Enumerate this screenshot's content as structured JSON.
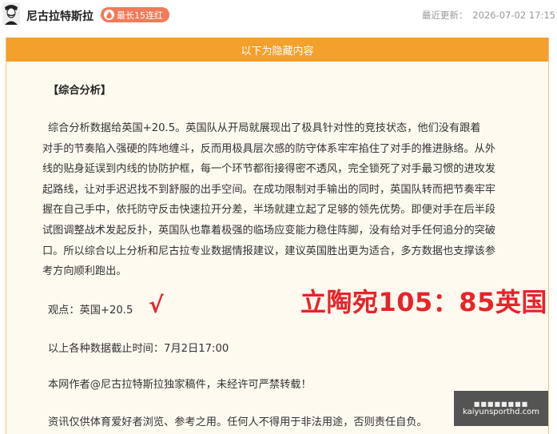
{
  "header": {
    "author": "尼古拉特斯拉",
    "badge": "最长15连红",
    "updated_label": "最近更新：",
    "updated_time": "2026-07-02 17:15"
  },
  "card": {
    "hidden_banner": "以下为隐藏内容",
    "section_title": "【综合分析】",
    "paragraph_lines": [
      "综合分析数据给英国+20.5。英国队从开局就展现出了极具针对性的竞技状态，他们没有跟着",
      "对手的节奏陷入强硬的阵地缠斗，反而用极具层次感的防守体系牢牢掐住了对手的推进脉络。从外",
      "线的贴身延误到内线的协防护框，每一个环节都衔接得密不透风，完全锁死了对手最习惯的进攻发",
      "起路线，让对手迟迟找不到舒服的出手空间。在成功限制对手输出的同时，英国队转而把节奏牢牢",
      "握在自己手中，依托防守反击快速拉开分差，半场就建立起了足够的领先优势。即便对手在后半段",
      "试图调整战术发起反扑，英国队也靠着极强的临场应变能力稳住阵脚，没有给对手任何追分的突破",
      "口。所以综合以上分析和尼古拉专业数据情报建议，建议英国胜出更为适合，多方数据也支撑该参",
      "考方向顺利跑出。"
    ],
    "viewpoint": "观点：英国+20.5",
    "check_mark": "√",
    "score": "立陶宛105：85英国",
    "deadline": "以上各种数据截止时间：7月2日17:00",
    "copyright": "本网作者@尼古拉特斯拉独家稿件，未经许可严禁转载！",
    "disclaimer": "资讯仅供体育爱好者浏览、参考之用。任何人不得用于非法用途，否则责任自负。"
  },
  "watermark": {
    "top": "■■■■■■■■",
    "url": "kaiyunsporthd.com"
  },
  "colors": {
    "banner": "#f4a02c",
    "card_bg": "#fffaf0",
    "badge": "#f07b5a",
    "highlight_red": "#e8232a"
  }
}
